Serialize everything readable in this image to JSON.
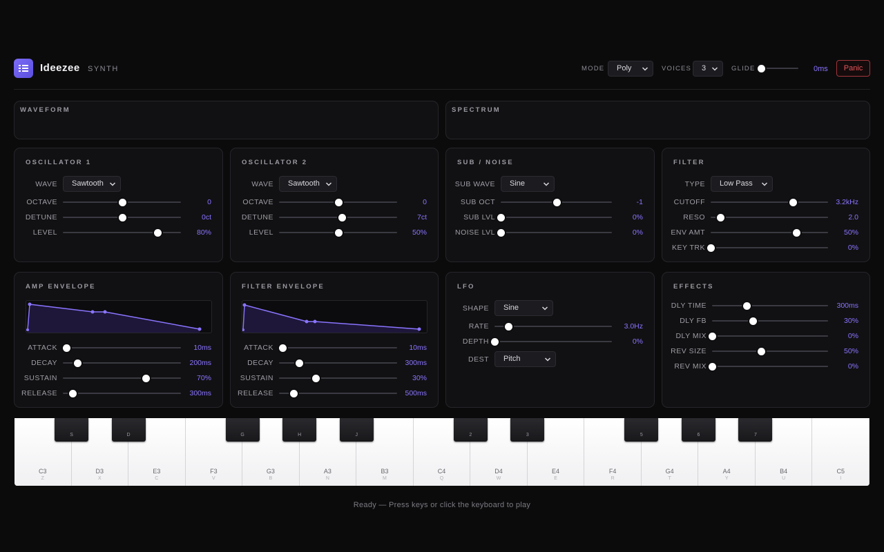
{
  "app": {
    "name": "Ideezee",
    "sub": "SYNTH"
  },
  "header": {
    "mode_label": "MODE",
    "mode_value": "Poly",
    "voices_label": "VOICES",
    "voices_value": "3",
    "glide_label": "GLIDE",
    "glide_value": "0ms",
    "glide_level": 0,
    "panic_label": "Panic",
    "accent": "#8a74ff"
  },
  "displays": {
    "waveform": "WAVEFORM",
    "spectrum": "SPECTRUM"
  },
  "osc1": {
    "title": "OSCILLATOR 1",
    "wave_label": "WAVE",
    "wave_value": "Sawtooth",
    "rows": [
      {
        "label": "OCTAVE",
        "value": "0",
        "level": 0.5
      },
      {
        "label": "DETUNE",
        "value": "0ct",
        "level": 0.5
      },
      {
        "label": "LEVEL",
        "value": "80%",
        "level": 0.8
      }
    ]
  },
  "osc2": {
    "title": "OSCILLATOR 2",
    "wave_label": "WAVE",
    "wave_value": "Sawtooth",
    "rows": [
      {
        "label": "OCTAVE",
        "value": "0",
        "level": 0.5
      },
      {
        "label": "DETUNE",
        "value": "7ct",
        "level": 0.53
      },
      {
        "label": "LEVEL",
        "value": "50%",
        "level": 0.5
      }
    ]
  },
  "sub": {
    "title": "SUB / NOISE",
    "wave_label": "SUB WAVE",
    "wave_value": "Sine",
    "rows": [
      {
        "label": "SUB OCT",
        "value": "-1",
        "level": 0.5
      },
      {
        "label": "SUB LVL",
        "value": "0%",
        "level": 0
      },
      {
        "label": "NOISE LVL",
        "value": "0%",
        "level": 0
      }
    ]
  },
  "filter": {
    "title": "FILTER",
    "type_label": "TYPE",
    "type_value": "Low Pass",
    "rows": [
      {
        "label": "CUTOFF",
        "value": "3.2kHz",
        "level": 0.7
      },
      {
        "label": "RESO",
        "value": "2.0",
        "level": 0.08
      },
      {
        "label": "ENV AMT",
        "value": "50%",
        "level": 0.73
      },
      {
        "label": "KEY TRK",
        "value": "0%",
        "level": 0
      }
    ]
  },
  "amp_env": {
    "title": "AMP ENVELOPE",
    "rows": [
      {
        "label": "ATTACK",
        "value": "10ms",
        "level": 0.03
      },
      {
        "label": "DECAY",
        "value": "200ms",
        "level": 0.12
      },
      {
        "label": "SUSTAIN",
        "value": "70%",
        "level": 0.7
      },
      {
        "label": "RELEASE",
        "value": "300ms",
        "level": 0.08
      }
    ]
  },
  "filter_env": {
    "title": "FILTER ENVELOPE",
    "rows": [
      {
        "label": "ATTACK",
        "value": "10ms",
        "level": 0.03
      },
      {
        "label": "DECAY",
        "value": "300ms",
        "level": 0.17
      },
      {
        "label": "SUSTAIN",
        "value": "30%",
        "level": 0.31
      },
      {
        "label": "RELEASE",
        "value": "500ms",
        "level": 0.12
      }
    ]
  },
  "lfo": {
    "title": "LFO",
    "shape_label": "SHAPE",
    "shape_value": "Sine",
    "dest_label": "DEST",
    "dest_value": "Pitch",
    "rows": [
      {
        "label": "RATE",
        "value": "3.0Hz",
        "level": 0.12
      },
      {
        "label": "DEPTH",
        "value": "0%",
        "level": 0
      }
    ]
  },
  "effects": {
    "title": "EFFECTS",
    "rows": [
      {
        "label": "DLY TIME",
        "value": "300ms",
        "level": 0.3
      },
      {
        "label": "DLY FB",
        "value": "30%",
        "level": 0.35
      },
      {
        "label": "DLY MIX",
        "value": "0%",
        "level": 0
      },
      {
        "label": "REV SIZE",
        "value": "50%",
        "level": 0.42
      },
      {
        "label": "REV MIX",
        "value": "0%",
        "level": 0
      }
    ]
  },
  "keyboard": {
    "white_keys": [
      {
        "note": "C3",
        "key": "Z"
      },
      {
        "note": "D3",
        "key": "X"
      },
      {
        "note": "E3",
        "key": "C"
      },
      {
        "note": "F3",
        "key": "V"
      },
      {
        "note": "G3",
        "key": "B"
      },
      {
        "note": "A3",
        "key": "N"
      },
      {
        "note": "B3",
        "key": "M"
      },
      {
        "note": "C4",
        "key": "Q"
      },
      {
        "note": "D4",
        "key": "W"
      },
      {
        "note": "E4",
        "key": "E"
      },
      {
        "note": "F4",
        "key": "R"
      },
      {
        "note": "G4",
        "key": "T"
      },
      {
        "note": "A4",
        "key": "Y"
      },
      {
        "note": "B4",
        "key": "U"
      },
      {
        "note": "C5",
        "key": "I"
      }
    ],
    "black_keys": [
      {
        "key": "S",
        "after": 0
      },
      {
        "key": "D",
        "after": 1
      },
      {
        "key": "G",
        "after": 3
      },
      {
        "key": "H",
        "after": 4
      },
      {
        "key": "J",
        "after": 5
      },
      {
        "key": "2",
        "after": 7
      },
      {
        "key": "3",
        "after": 8
      },
      {
        "key": "5",
        "after": 10
      },
      {
        "key": "6",
        "after": 11
      },
      {
        "key": "7",
        "after": 12
      }
    ]
  },
  "status": "Ready — Press keys or click the keyboard to play"
}
